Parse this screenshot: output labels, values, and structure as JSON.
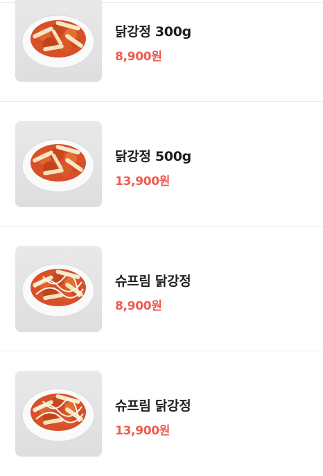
{
  "menu": {
    "items": [
      {
        "name": "닭강정 300g",
        "price": "8,900원",
        "image": "fried-chicken-tteok-dish",
        "sauce": false
      },
      {
        "name": "닭강정 500g",
        "price": "13,900원",
        "image": "fried-chicken-tteok-dish",
        "sauce": false
      },
      {
        "name": "슈프림 닭강정",
        "price": "8,900원",
        "image": "supreme-fried-chicken-dish",
        "sauce": true
      },
      {
        "name": "슈프림 닭강정",
        "price": "13,900원",
        "image": "supreme-fried-chicken-dish",
        "sauce": true
      }
    ]
  },
  "colors": {
    "price": "#ef5a4f",
    "name": "#1f1f1f",
    "divider": "#ececec"
  }
}
